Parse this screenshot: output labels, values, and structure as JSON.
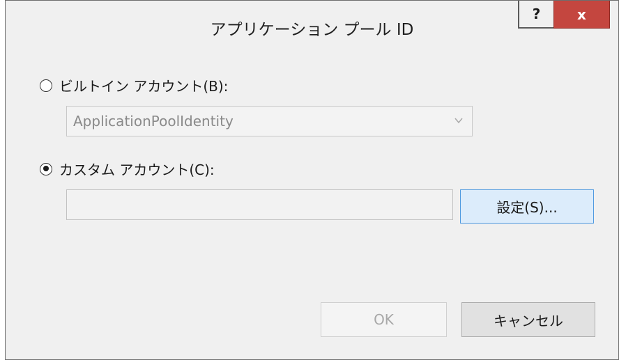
{
  "window": {
    "title": "アプリケーション プール ID",
    "help_label": "?",
    "close_label": "x"
  },
  "builtin": {
    "label": "ビルトイン アカウント(B):",
    "selected": false,
    "dropdown_value": "ApplicationPoolIdentity",
    "enabled": false
  },
  "custom": {
    "label": "カスタム アカウント(C):",
    "selected": true,
    "account_value": "",
    "set_button_label": "設定(S)..."
  },
  "footer": {
    "ok_label": "OK",
    "ok_enabled": false,
    "cancel_label": "キャンセル"
  },
  "colors": {
    "close_button": "#c4463f",
    "focused_button_border": "#4f9ae0",
    "focused_button_fill": "#dcecfb"
  }
}
